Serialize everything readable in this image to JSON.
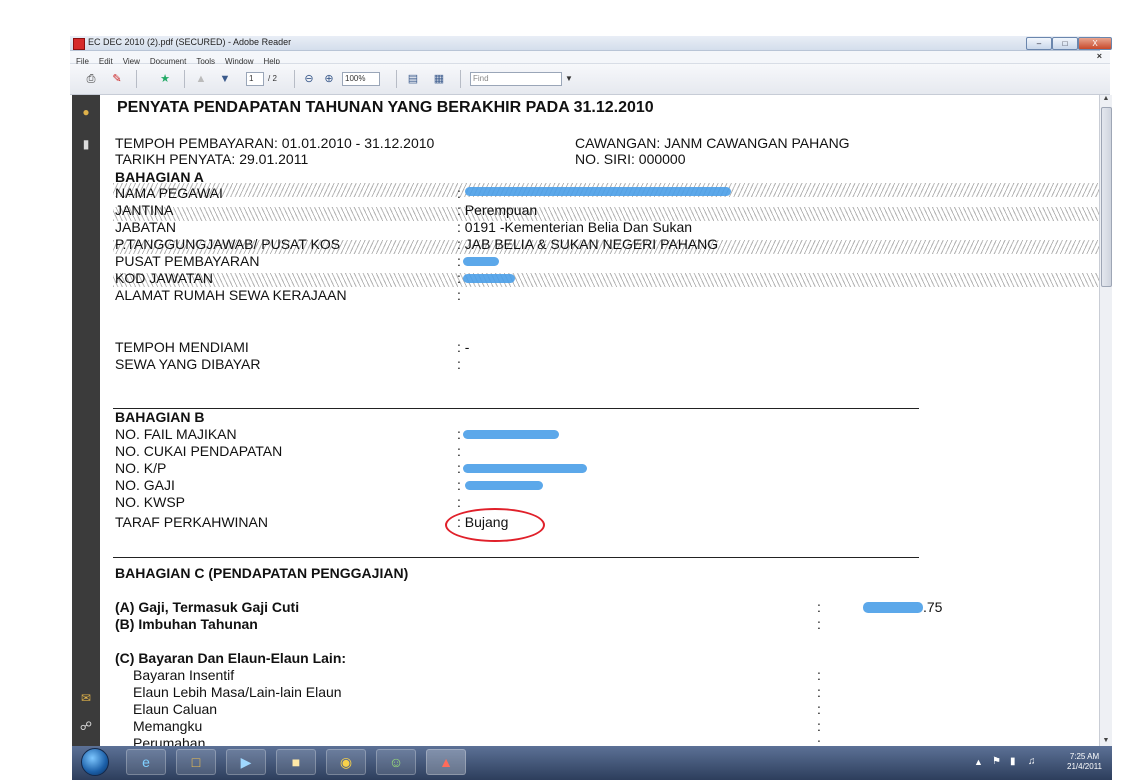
{
  "window": {
    "title": "EC DEC 2010 (2).pdf (SECURED) - Adobe Reader",
    "minimize": "–",
    "maximize": "□",
    "close": "X"
  },
  "menu": {
    "items": [
      "File",
      "Edit",
      "View",
      "Document",
      "Tools",
      "Window",
      "Help"
    ],
    "close_doc": "×"
  },
  "toolbar": {
    "page_current": "1",
    "page_total": "/ 2",
    "zoom": "100%",
    "find_placeholder": "Find"
  },
  "document": {
    "heading": "PENYATA PENDAPATAN TAHUNAN YANG BERAKHIR PADA 31.12.2010",
    "tempoh_pembayaran": "TEMPOH PEMBAYARAN: 01.01.2010 - 31.12.2010",
    "tarikh_penyata": "TARIKH PENYATA: 29.01.2011",
    "cawangan": "CAWANGAN: JANM CAWANGAN PAHANG",
    "no_siri": "NO. SIRI:  000000",
    "bahagian_a": {
      "heading": "BAHAGIAN A",
      "rows": [
        {
          "label": "NAMA PEGAWAI",
          "value": ":"
        },
        {
          "label": "JANTINA",
          "value": ": Perempuan"
        },
        {
          "label": "JABATAN",
          "value": ": 0191 -Kementerian Belia Dan Sukan"
        },
        {
          "label": "P.TANGGUNGJAWAB/ PUSAT KOS",
          "value": ": JAB BELIA & SUKAN NEGERI PAHANG"
        },
        {
          "label": "PUSAT PEMBAYARAN",
          "value": ":"
        },
        {
          "label": "KOD JAWATAN",
          "value": ":"
        },
        {
          "label": "ALAMAT RUMAH SEWA KERAJAAN",
          "value": ":"
        },
        {
          "label": "TEMPOH MENDIAMI",
          "value": ": -"
        },
        {
          "label": "SEWA YANG DIBAYAR",
          "value": ":"
        }
      ]
    },
    "bahagian_b": {
      "heading": "BAHAGIAN B",
      "rows": [
        {
          "label": "NO. FAIL MAJIKAN",
          "value": ":"
        },
        {
          "label": "NO. CUKAI PENDAPATAN",
          "value": ":"
        },
        {
          "label": "NO. K/P",
          "value": ":"
        },
        {
          "label": "NO. GAJI",
          "value": ":"
        },
        {
          "label": "NO. KWSP",
          "value": ":"
        },
        {
          "label": "TARAF PERKAHWINAN",
          "value": ": Bujang"
        }
      ]
    },
    "bahagian_c": {
      "heading": "BAHAGIAN C (PENDAPATAN PENGGAJIAN)",
      "a_label": "(A) Gaji, Termasuk Gaji Cuti",
      "a_value": ".75",
      "b_label": "(B) Imbuhan Tahunan",
      "c_label": "(C) Bayaran Dan Elaun-Elaun Lain:",
      "c_items": [
        "Bayaran Insentif",
        "Elaun Lebih Masa/Lain-lain Elaun",
        "Elaun Caluan",
        "Memangku",
        "Perumahan"
      ],
      "colon": ":"
    }
  },
  "taskbar": {
    "time": "7:25 AM",
    "date": "21/4/2011"
  },
  "colors": {
    "redaction": "#4a9fe8",
    "circle": "#e0202a",
    "nav_bg": "#3b3b3b"
  }
}
